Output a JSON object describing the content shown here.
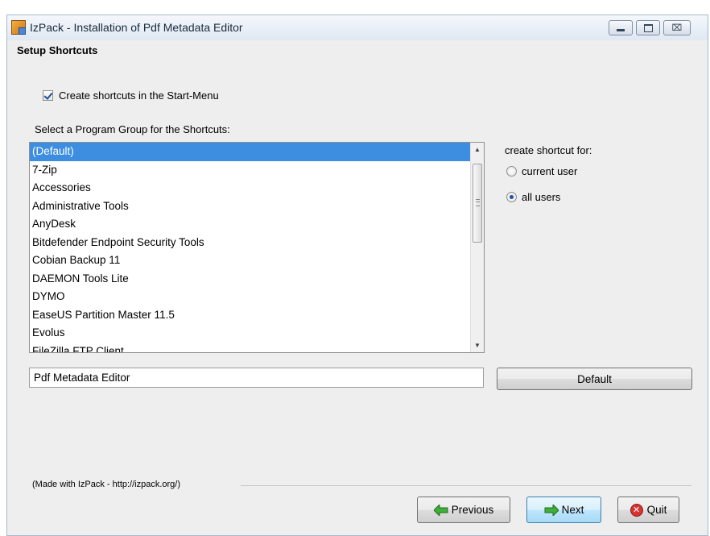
{
  "window": {
    "title": "IzPack - Installation of  Pdf Metadata Editor",
    "controls": {
      "minimize": "minimize",
      "maximize": "maximize",
      "close": "⌧"
    }
  },
  "panel": {
    "title": "Setup Shortcuts",
    "create_shortcuts_label": "Create shortcuts in the Start-Menu",
    "create_shortcuts_checked": true,
    "program_group_label": "Select a Program Group for the Shortcuts:",
    "program_groups": [
      "(Default)",
      "7-Zip",
      "Accessories",
      "Administrative Tools",
      "AnyDesk",
      "Bitdefender Endpoint Security Tools",
      "Cobian Backup 11",
      "DAEMON Tools Lite",
      "DYMO",
      "EaseUS Partition Master 11.5",
      "Evolus",
      "FileZilla FTP Client"
    ],
    "selected_group": "(Default)",
    "create_for_label": "create shortcut for:",
    "radio_current_user": "current user",
    "radio_all_users": "all users",
    "selected_scope": "all users",
    "group_name_value": "Pdf Metadata Editor",
    "default_button": "Default"
  },
  "footer": {
    "made_with": "(Made with IzPack - http://izpack.org/)",
    "previous_button": "Previous",
    "next_button": "Next",
    "quit_button": "Quit"
  },
  "colors": {
    "selection": "#3d8ee0",
    "window_bg": "#eeeeee",
    "next_accent": "#a7d9f5",
    "quit_icon": "#d7332f",
    "arrow_green": "#3fae3a"
  },
  "icons": {
    "app": "izpack-app-icon",
    "previous": "green-left-arrow-icon",
    "next": "green-right-arrow-icon",
    "quit": "red-x-circle-icon"
  }
}
